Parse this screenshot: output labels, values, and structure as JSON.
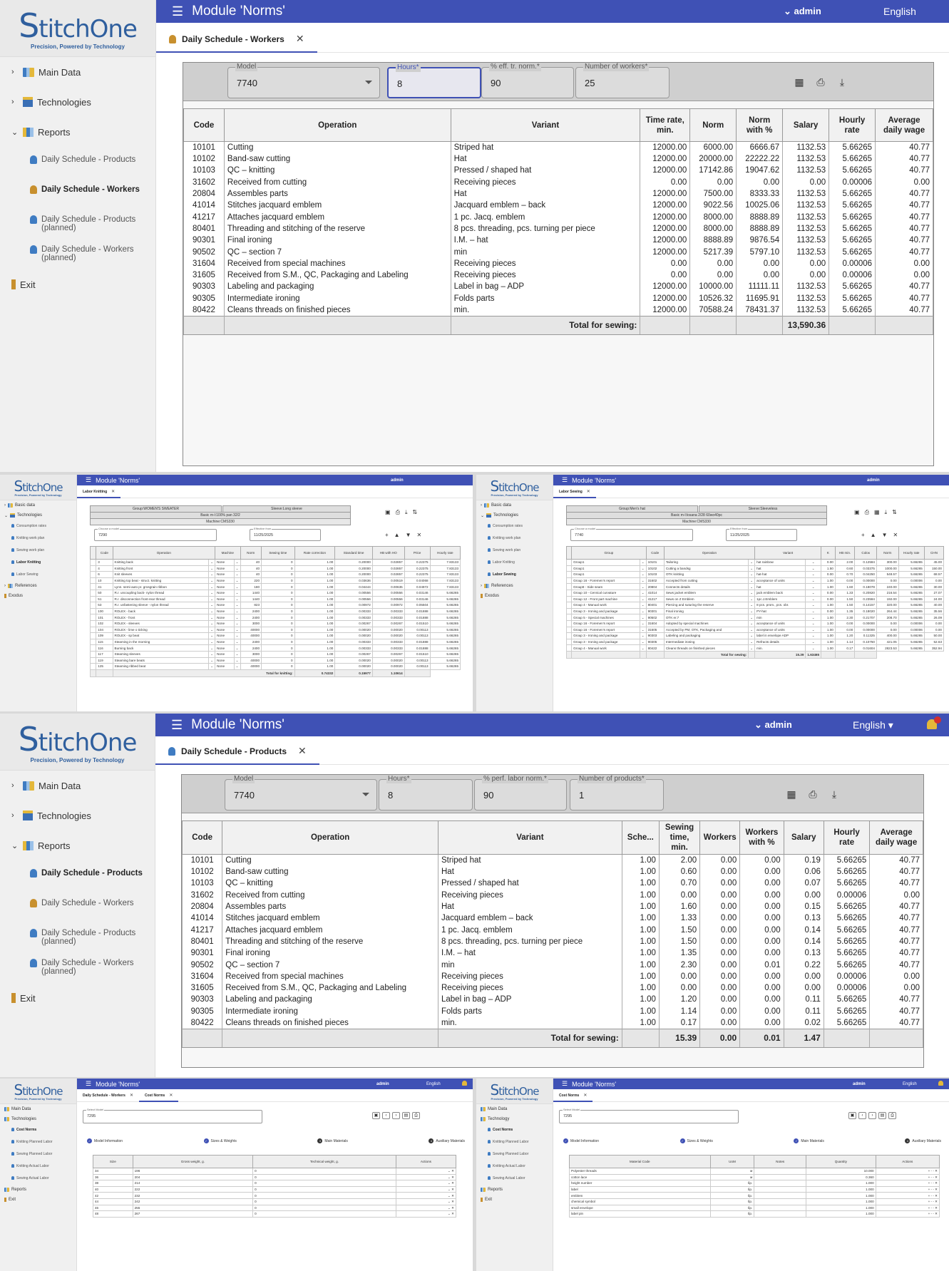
{
  "brand": {
    "name_first": "S",
    "name_rest": "titchOne",
    "tagline": "Precision, Powered by Technology"
  },
  "app": {
    "title": "Module 'Norms'",
    "user": "admin",
    "language": "English"
  },
  "sidebar": {
    "main_data": "Main Data",
    "technologies": "Technologies",
    "reports": "Reports",
    "daily_products": "Daily Schedule - Products",
    "daily_workers": "Daily Schedule - Workers",
    "daily_products_planned": "Daily Schedule - Products (planned)",
    "daily_workers_planned": "Daily Schedule - Workers (planned)",
    "exit": "Exit"
  },
  "workers": {
    "tab": "Daily Schedule - Workers",
    "model_label": "Model",
    "model": "7740",
    "hours_label": "Hours*",
    "hours": "8",
    "eff_label": "% eff. tr. norm.*",
    "eff": "90",
    "workers_label": "Number of workers*",
    "workers": "25",
    "headers": [
      "Code",
      "Operation",
      "Variant",
      "Time rate, min.",
      "Norm",
      "Norm with %",
      "Salary",
      "Hourly rate",
      "Average daily wage"
    ],
    "rows": [
      [
        "10101",
        "Cutting",
        "Striped hat",
        "12000.00",
        "6000.00",
        "6666.67",
        "1132.53",
        "5.66265",
        "40.77"
      ],
      [
        "10102",
        "Band-saw cutting",
        "Hat",
        "12000.00",
        "20000.00",
        "22222.22",
        "1132.53",
        "5.66265",
        "40.77"
      ],
      [
        "10103",
        "QC – knitting",
        "Pressed / shaped hat",
        "12000.00",
        "17142.86",
        "19047.62",
        "1132.53",
        "5.66265",
        "40.77"
      ],
      [
        "31602",
        "Received from cutting",
        "Receiving pieces",
        "0.00",
        "0.00",
        "0.00",
        "0.00",
        "0.00006",
        "0.00"
      ],
      [
        "20804",
        "Assembles parts",
        "Hat",
        "12000.00",
        "7500.00",
        "8333.33",
        "1132.53",
        "5.66265",
        "40.77"
      ],
      [
        "41014",
        "Stitches jacquard emblem",
        "Jacquard emblem – back",
        "12000.00",
        "9022.56",
        "10025.06",
        "1132.53",
        "5.66265",
        "40.77"
      ],
      [
        "41217",
        "Attaches jacquard emblem",
        "1 pc. Jacq. emblem",
        "12000.00",
        "8000.00",
        "8888.89",
        "1132.53",
        "5.66265",
        "40.77"
      ],
      [
        "80401",
        "Threading and stitching of the reserve",
        "8 pcs. threading, pcs. turning per piece",
        "12000.00",
        "8000.00",
        "8888.89",
        "1132.53",
        "5.66265",
        "40.77"
      ],
      [
        "90301",
        "Final ironing",
        "I.M. – hat",
        "12000.00",
        "8888.89",
        "9876.54",
        "1132.53",
        "5.66265",
        "40.77"
      ],
      [
        "90502",
        "QC – section 7",
        "min",
        "12000.00",
        "5217.39",
        "5797.10",
        "1132.53",
        "5.66265",
        "40.77"
      ],
      [
        "31604",
        "Received from special machines",
        "Receiving pieces",
        "0.00",
        "0.00",
        "0.00",
        "0.00",
        "0.00006",
        "0.00"
      ],
      [
        "31605",
        "Received from S.M., QC, Packaging and Labeling",
        "Receiving pieces",
        "0.00",
        "0.00",
        "0.00",
        "0.00",
        "0.00006",
        "0.00"
      ],
      [
        "90303",
        "Labeling and packaging",
        "Label in bag – ADP",
        "12000.00",
        "10000.00",
        "11111.11",
        "1132.53",
        "5.66265",
        "40.77"
      ],
      [
        "90305",
        "Intermediate ironing",
        "Folds parts",
        "12000.00",
        "10526.32",
        "11695.91",
        "1132.53",
        "5.66265",
        "40.77"
      ],
      [
        "80422",
        "Cleans threads on finished pieces",
        "min.",
        "12000.00",
        "70588.24",
        "78431.37",
        "1132.53",
        "5.66265",
        "40.77"
      ]
    ],
    "total_label": "Total for sewing:",
    "total_salary": "13,590.36"
  },
  "products": {
    "tab": "Daily Schedule - Products",
    "model_label": "Model",
    "model": "7740",
    "hours_label": "Hours*",
    "hours": "8",
    "perf_label": "% perf. labor norm.*",
    "perf": "90",
    "products_label": "Number of products*",
    "products": "1",
    "headers": [
      "Code",
      "Operation",
      "Variant",
      "Sche...",
      "Sewing time, min.",
      "Workers",
      "Workers with %",
      "Salary",
      "Hourly rate",
      "Average daily wage"
    ],
    "rows": [
      [
        "10101",
        "Cutting",
        "Striped hat",
        "1.00",
        "2.00",
        "0.00",
        "0.00",
        "0.19",
        "5.66265",
        "40.77"
      ],
      [
        "10102",
        "Band-saw cutting",
        "Hat",
        "1.00",
        "0.60",
        "0.00",
        "0.00",
        "0.06",
        "5.66265",
        "40.77"
      ],
      [
        "10103",
        "QC – knitting",
        "Pressed / shaped hat",
        "1.00",
        "0.70",
        "0.00",
        "0.00",
        "0.07",
        "5.66265",
        "40.77"
      ],
      [
        "31602",
        "Received from cutting",
        "Receiving pieces",
        "1.00",
        "0.00",
        "0.00",
        "0.00",
        "0.00",
        "0.00006",
        "0.00"
      ],
      [
        "20804",
        "Assembles parts",
        "Hat",
        "1.00",
        "1.60",
        "0.00",
        "0.00",
        "0.15",
        "5.66265",
        "40.77"
      ],
      [
        "41014",
        "Stitches jacquard emblem",
        "Jacquard emblem – back",
        "1.00",
        "1.33",
        "0.00",
        "0.00",
        "0.13",
        "5.66265",
        "40.77"
      ],
      [
        "41217",
        "Attaches jacquard emblem",
        "1 pc. Jacq. emblem",
        "1.00",
        "1.50",
        "0.00",
        "0.00",
        "0.14",
        "5.66265",
        "40.77"
      ],
      [
        "80401",
        "Threading and stitching of the reserve",
        "8 pcs. threading, pcs. turning per piece",
        "1.00",
        "1.50",
        "0.00",
        "0.00",
        "0.14",
        "5.66265",
        "40.77"
      ],
      [
        "90301",
        "Final ironing",
        "I.M. – hat",
        "1.00",
        "1.35",
        "0.00",
        "0.00",
        "0.13",
        "5.66265",
        "40.77"
      ],
      [
        "90502",
        "QC – section 7",
        "min",
        "1.00",
        "2.30",
        "0.00",
        "0.01",
        "0.22",
        "5.66265",
        "40.77"
      ],
      [
        "31604",
        "Received from special machines",
        "Receiving pieces",
        "1.00",
        "0.00",
        "0.00",
        "0.00",
        "0.00",
        "0.00006",
        "0.00"
      ],
      [
        "31605",
        "Received from S.M., QC, Packaging and Labeling",
        "Receiving pieces",
        "1.00",
        "0.00",
        "0.00",
        "0.00",
        "0.00",
        "0.00006",
        "0.00"
      ],
      [
        "90303",
        "Labeling and packaging",
        "Label in bag – ADP",
        "1.00",
        "1.20",
        "0.00",
        "0.00",
        "0.11",
        "5.66265",
        "40.77"
      ],
      [
        "90305",
        "Intermediate ironing",
        "Folds parts",
        "1.00",
        "1.14",
        "0.00",
        "0.00",
        "0.11",
        "5.66265",
        "40.77"
      ],
      [
        "80422",
        "Cleans threads on finished pieces",
        "min.",
        "1.00",
        "0.17",
        "0.00",
        "0.00",
        "0.02",
        "5.66265",
        "40.77"
      ]
    ],
    "total_label": "Total for sewing:",
    "total_time": "15.39",
    "total_workers": "0.00",
    "total_workers_pct": "0.01",
    "total_salary": "1.47"
  },
  "knitting": {
    "tab": "Labor Knitting",
    "group": "Group:WOMEN'S SWEATER",
    "sleeve": "Sleeve:Long sleeve",
    "basic": "Basic m-l:100% pan 32/2",
    "machine": "Machine:CMS330",
    "model_label": "Choose a model",
    "model": "7290",
    "date_label": "Effective from",
    "date": "11/25/2025",
    "headers": [
      "Code",
      "Operation",
      "Machine",
      "Norm",
      "Sewing time",
      "Rate correction",
      "Standard time",
      "НВ with НО",
      "Price",
      "Hourly rate"
    ],
    "rows": [
      [
        "3",
        "Knitting back",
        "None",
        "40",
        "0",
        "1.00",
        "0.20000",
        "0.02857",
        "0.22375",
        "7.83133"
      ],
      [
        "4",
        "Knitting front",
        "None",
        "40",
        "0",
        "1.00",
        "0.20000",
        "0.02857",
        "0.22375",
        "7.83133"
      ],
      [
        "6",
        "Knit sleeves",
        "None",
        "40",
        "0",
        "1.00",
        "0.20000",
        "0.02857",
        "0.22375",
        "7.83133"
      ],
      [
        "10",
        "Knitting top beat - struct. knitting",
        "None",
        "220",
        "0",
        "1.00",
        "0.03636",
        "0.00519",
        "0.04068",
        "7.83133"
      ],
      [
        "41",
        "Lynn. semi-auto pr. grosgrain ribbon",
        "None",
        "180",
        "0",
        "1.00",
        "0.04444",
        "0.00635",
        "0.04972",
        "7.83133"
      ],
      [
        "50",
        "R.r. uncoupling back- nylon thread",
        "None",
        "1440",
        "0",
        "1.00",
        "0.00556",
        "0.00556",
        "0.03146",
        "5.66265"
      ],
      [
        "51",
        "R.r. disconnection front-rear thread",
        "None",
        "1440",
        "0",
        "1.00",
        "0.00556",
        "0.00556",
        "0.03146",
        "5.66265"
      ],
      [
        "53",
        "R.r. unfastening sleeve - nylon thread",
        "None",
        "823",
        "0",
        "1.00",
        "0.00972",
        "0.00972",
        "0.05504",
        "5.66265"
      ],
      [
        "100",
        "ROLEX - back",
        "None",
        "2400",
        "0",
        "1.00",
        "0.00333",
        "0.00333",
        "0.01888",
        "5.66265"
      ],
      [
        "101",
        "ROLEX - front",
        "None",
        "2400",
        "0",
        "1.00",
        "0.00333",
        "0.00333",
        "0.01888",
        "5.66265"
      ],
      [
        "102",
        "ROLEX - sleeves",
        "None",
        "3000",
        "0",
        "1.00",
        "0.00267",
        "0.00267",
        "0.01510",
        "5.66265"
      ],
      [
        "104",
        "ROLEX - lime o ticking",
        "None",
        "40000",
        "0",
        "1.00",
        "0.00020",
        "0.00020",
        "0.00113",
        "5.66265"
      ],
      [
        "109",
        "ROLEX - sp beat",
        "None",
        "40000",
        "0",
        "1.00",
        "0.00020",
        "0.00020",
        "0.00113",
        "5.66265"
      ],
      [
        "115",
        "Steaming in the morning",
        "None",
        "2400",
        "0",
        "1.00",
        "0.00333",
        "0.00333",
        "0.01888",
        "5.66265"
      ],
      [
        "116",
        "Burning back",
        "None",
        "2400",
        "0",
        "1.00",
        "0.00333",
        "0.00333",
        "0.01888",
        "5.66265"
      ],
      [
        "117",
        "Steaming sleeves",
        "None",
        "3000",
        "0",
        "1.00",
        "0.00267",
        "0.00267",
        "0.01510",
        "5.66265"
      ],
      [
        "119",
        "Steaming bare beats",
        "None",
        "40000",
        "0",
        "1.00",
        "0.00020",
        "0.00020",
        "0.00113",
        "5.66265"
      ],
      [
        "125",
        "Steaming ribbed beat",
        "None",
        "40000",
        "0",
        "1.00",
        "0.00020",
        "0.00020",
        "0.00113",
        "5.66265"
      ]
    ],
    "total_label": "Total for knitting:",
    "total_std": "0.74332",
    "total_nv": "0.15977",
    "total_price": "1.10614"
  },
  "sewing": {
    "tab": "Labor Sewing",
    "group": "Group:Men's hat",
    "sleeve": "Sleeve:Sleeveless",
    "basic": "Basic m-l:losana 2/28 60wo40pc",
    "machine": "Machine:CMS330",
    "model_label": "Choose a model",
    "model": "7740",
    "date_label": "Effective from",
    "date": "11/25/2025",
    "headers": [
      "Group",
      "Code",
      "Operation",
      "Variant",
      "K",
      "НВ min.",
      "Coloк",
      "Norm",
      "Hourly rate",
      "СНN"
    ],
    "rows": [
      [
        "Group1",
        "10101",
        "Tailoring",
        "hat rainbow",
        "0.00",
        "2.00",
        "0.12584",
        "300.00",
        "5.66265",
        "45.00"
      ],
      [
        "Group1",
        "10102",
        "Cutting a bandsg",
        "hat",
        "1.50",
        "0.60",
        "0.03375",
        "1000.00",
        "5.66265",
        "150.00"
      ],
      [
        "Group1",
        "10103",
        "OTK knitting",
        "hat-hat",
        "0.00",
        "0.70",
        "0.04250",
        "548.57",
        "5.66265",
        "68.57"
      ],
      [
        "Group 16 - Foremen's report",
        "31602",
        "Accepted from cutting",
        "acceptance of units",
        "1.00",
        "0.00",
        "0.00000",
        "0.00",
        "0.00006",
        "0.00"
      ],
      [
        "Group8 - Side seam",
        "20804",
        "Connects details",
        "hat",
        "1.00",
        "1.60",
        "0.18078",
        "240.00",
        "5.66265",
        "30.00"
      ],
      [
        "Group 10 - Cervical curvature",
        "41014",
        "Sews jacket emblem",
        "jack emblem back",
        "0.00",
        "1.33",
        "0.20820",
        "216.54",
        "5.66265",
        "27.07"
      ],
      [
        "Group 12 - Front part machine",
        "41217",
        "Sews on Z Emblem",
        "1pc.J.Emblem",
        "0.00",
        "1.50",
        "0.23584",
        "192.00",
        "5.66265",
        "24.00"
      ],
      [
        "Group 4 - Manual work",
        "80401",
        "Piercing and suturing the reserve",
        "8 pcs. prom., pcs. obr.",
        "1.00",
        "1.50",
        "0.14157",
        "320.00",
        "5.66265",
        "40.00"
      ],
      [
        "Group 3 - Ironing and package",
        "90301",
        "Final ironing",
        "PY-hat",
        "0.00",
        "1.35",
        "0.18020",
        "264.44",
        "5.66265",
        "35.56"
      ],
      [
        "Group 5 - Special machines",
        "90502",
        "OTK er.7",
        "min",
        "1.00",
        "2.30",
        "0.21707",
        "208.70",
        "5.66265",
        "26.09"
      ],
      [
        "Group 16 - Foremen's report",
        "31604",
        "Adopted by special machines",
        "acceptance of units",
        "1.00",
        "0.00",
        "0.00000",
        "0.00",
        "0.00006",
        "0.00"
      ],
      [
        "Group 16 - Foremen's report",
        "31605",
        "Accepted by PM, OTK, Packaging and",
        "acceptance of units",
        "1.00",
        "0.00",
        "0.00000",
        "0.00",
        "0.00006",
        "0.00"
      ],
      [
        "Group 3 - Ironing and package",
        "90303",
        "Labeling and packaging",
        "label in envelope ADP",
        "1.00",
        "1.20",
        "0.11325",
        "400.00",
        "5.66265",
        "50.00"
      ],
      [
        "Group 3 - Ironing and package",
        "90305",
        "Intermediate ironing",
        "Refracts details",
        "1.00",
        "1.14",
        "0.10750",
        "421.05",
        "5.66265",
        "52.63"
      ],
      [
        "Group 4 - Manual work",
        "80422",
        "Cleans threads on finished pieces",
        "min.",
        "1.00",
        "0.17",
        "0.01604",
        "2823.53",
        "5.66265",
        "352.94"
      ]
    ],
    "total_label": "Total for sewing:",
    "total_time": "15.39",
    "total_color": "1.63465"
  },
  "cost1": {
    "tab_workers": "Daily Schedule - Workers",
    "tab": "Cost Norms",
    "model_label": "Select Model",
    "model": "7295",
    "steps": [
      "Model Information",
      "Sizes & Weights",
      "Main Materials",
      "Auxiliary Materials"
    ],
    "headers": [
      "Size",
      "Gross weight, g.",
      "Technical weight, g.",
      "Actions"
    ],
    "rows": [
      [
        "34",
        "196",
        "0"
      ],
      [
        "36",
        "204",
        "0"
      ],
      [
        "38",
        "214",
        "0"
      ],
      [
        "40",
        "222",
        "0"
      ],
      [
        "42",
        "232",
        "0"
      ],
      [
        "44",
        "242",
        "0"
      ],
      [
        "46",
        "255",
        "0"
      ],
      [
        "48",
        "267",
        "0"
      ]
    ],
    "sidebar": [
      "Main Data",
      "Technologies",
      "Cost Norms",
      "Knitting Planned Labor",
      "Sewing Planned Labor",
      "Knitting Actual Labor",
      "Sewing Actual Labor",
      "Reports",
      "Exit"
    ]
  },
  "cost2": {
    "tab": "Cost Norms",
    "model_label": "Select Model",
    "model": "7295",
    "steps": [
      "Model Information",
      "Sizes & Weights",
      "Main Materials",
      "Auxiliary Materials"
    ],
    "headers": [
      "Material Code",
      "UoM",
      "Notes",
      "Quantity",
      "Actions"
    ],
    "rows": [
      [
        "Polyester threads",
        "м",
        "10.000"
      ],
      [
        "cotton lace",
        "м",
        "0.360"
      ],
      [
        "height number",
        "бр.",
        "1.000"
      ],
      [
        "label",
        "бр.",
        "1.000"
      ],
      [
        "emblem",
        "бр.",
        "1.000"
      ],
      [
        "chemical symbol",
        "бр.",
        "1.000"
      ],
      [
        "small envelope",
        "бр.",
        "1.000"
      ],
      [
        "label pin",
        "бр.",
        "1.000"
      ]
    ],
    "sidebar": [
      "Main Data",
      "Technology",
      "Cost Norms",
      "Knitting Planned Labor",
      "Sewing Planned Labor",
      "Knitting Actual Labor",
      "Sewing Actual Labor",
      "Reports",
      "Exit"
    ]
  },
  "mini_sidebar": {
    "basic": "Basic data",
    "tech": "Technologies",
    "consumption": "Consumption rates",
    "knit_plan": "Knitting work plan",
    "sew_plan": "Sewing work plan",
    "knit": "Labor Knitting",
    "sew": "Labor Sewing",
    "refs": "References",
    "exit": "Exodus"
  }
}
